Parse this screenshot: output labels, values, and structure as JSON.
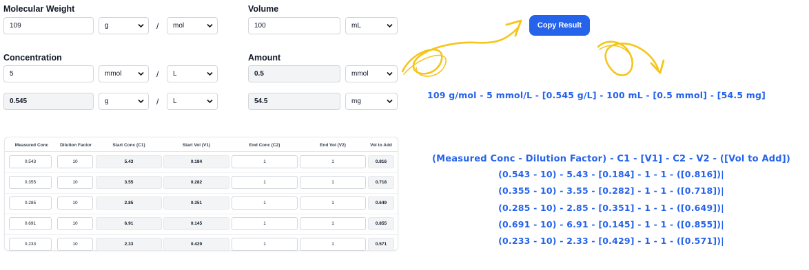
{
  "calculator": {
    "molecular_weight": {
      "label": "Molecular Weight",
      "value": "109",
      "unit1": "g",
      "unit2": "mol"
    },
    "volume": {
      "label": "Volume",
      "value": "100",
      "unit": "mL"
    },
    "concentration": {
      "label": "Concentration",
      "value": "5",
      "unit1": "mmol",
      "unit2": "L",
      "mass_value": "0.545",
      "mass_unit1": "g",
      "mass_unit2": "L"
    },
    "amount": {
      "label": "Amount",
      "value": "0.5",
      "unit": "mmol",
      "mass_value": "54.5",
      "mass_unit": "mg"
    },
    "slash": "/"
  },
  "copy_button": "Copy Result",
  "result_text": "109 g/mol - 5 mmol/L - [0.545 g/L] - 100 mL - [0.5 mmol] - [54.5 mg]",
  "dilution_table": {
    "headers": [
      "Measured Conc",
      "Dilution Factor",
      "Start Conc (C1)",
      "Start Vol (V1)",
      "End Conc (C2)",
      "End Vol (V2)",
      "Vol to Add"
    ],
    "rows": [
      [
        "0.543",
        "10",
        "5.43",
        "0.184",
        "1",
        "1",
        "0.816"
      ],
      [
        "0.355",
        "10",
        "3.55",
        "0.282",
        "1",
        "1",
        "0.718"
      ],
      [
        "0.285",
        "10",
        "2.85",
        "0.351",
        "1",
        "1",
        "0.649"
      ],
      [
        "0.691",
        "10",
        "6.91",
        "0.145",
        "1",
        "1",
        "0.855"
      ],
      [
        "0.233",
        "10",
        "2.33",
        "0.429",
        "1",
        "1",
        "0.571"
      ]
    ]
  },
  "table_result": [
    "(Measured Conc - Dilution Factor) - C1 - [V1] - C2 - V2 - ([Vol to Add])",
    "(0.543 - 10) - 5.43 - [0.184] - 1 - 1 - ([0.816])|",
    "(0.355 - 10) - 3.55 - [0.282] - 1 - 1 - ([0.718])|",
    "(0.285 - 10) - 2.85 - [0.351] - 1 - 1 - ([0.649])|",
    "(0.691 - 10) - 6.91 - [0.145] - 1 - 1 - ([0.855])|",
    "(0.233 - 10) - 2.33 - [0.429] - 1 - 1 - ([0.571])|"
  ],
  "colors": {
    "accent": "#2563eb",
    "arrow": "#f5c518"
  }
}
